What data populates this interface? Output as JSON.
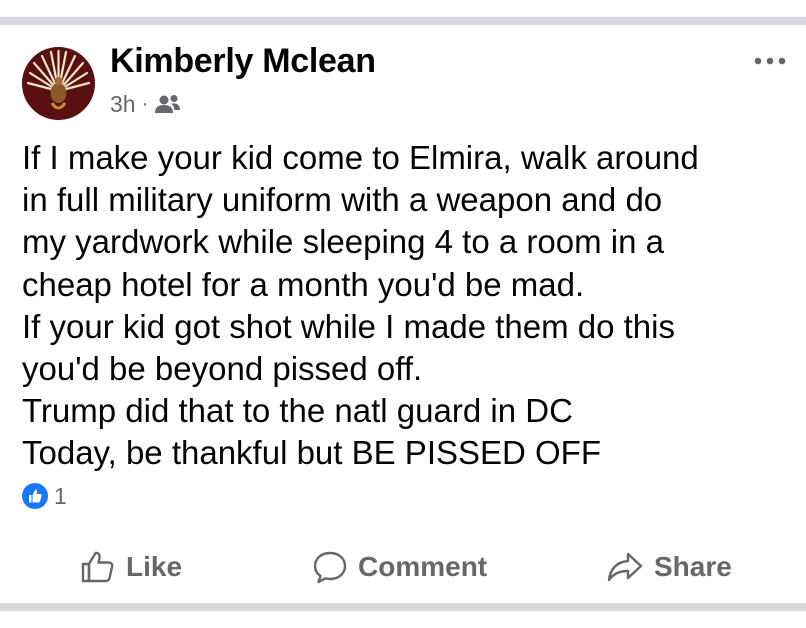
{
  "post": {
    "author": "Kimberly Mclean",
    "time": "3h",
    "separator": "·",
    "audience_icon": "friends-icon",
    "lines": [
      "If I make your kid come to Elmira, walk around",
      "in full military uniform with a weapon and do",
      "my yardwork while sleeping 4 to a room in a",
      "cheap hotel for a month you'd be mad.",
      "If your kid got shot while I made them do this",
      "you'd be beyond pissed off.",
      "Trump did that to the natl guard in DC",
      "Today, be thankful but BE PISSED OFF"
    ],
    "reaction_count": "1"
  },
  "actions": {
    "like_label": "Like",
    "comment_label": "Comment",
    "share_label": "Share"
  },
  "colors": {
    "text": "#050505",
    "secondary": "#65676b",
    "divider": "#d5d7dc",
    "like_blue": "#1877f2"
  }
}
